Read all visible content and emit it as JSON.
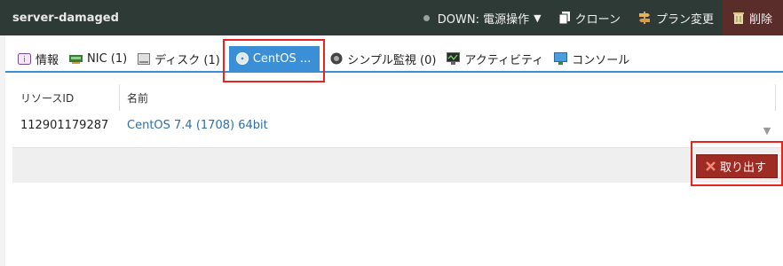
{
  "header": {
    "server_name": "server-damaged",
    "status_label": "DOWN: 電源操作",
    "clone_label": "クローン",
    "plan_change_label": "プラン変更",
    "delete_label": "削除"
  },
  "tabs": [
    {
      "label": "情報",
      "icon": "info-icon"
    },
    {
      "label": "NIC (1)",
      "icon": "nic-icon"
    },
    {
      "label": "ディスク (1)",
      "icon": "disk-icon"
    },
    {
      "label": "CentOS ...",
      "icon": "cdrom-icon",
      "active": true
    },
    {
      "label": "シンプル監視 (0)",
      "icon": "monitor-icon"
    },
    {
      "label": "アクティビティ",
      "icon": "activity-icon"
    },
    {
      "label": "コンソール",
      "icon": "console-icon"
    }
  ],
  "table": {
    "columns": [
      "リソースID",
      "名前"
    ],
    "rows": [
      {
        "resource_id": "112901179287",
        "name": "CentOS 7.4 (1708) 64bit"
      }
    ]
  },
  "footer": {
    "eject_label": "取り出す"
  },
  "colors": {
    "topbar": "#2e3a36",
    "accent": "#3a8fd6",
    "danger": "#9e2b24",
    "highlight": "#e8251c",
    "link": "#2e6fa8"
  }
}
